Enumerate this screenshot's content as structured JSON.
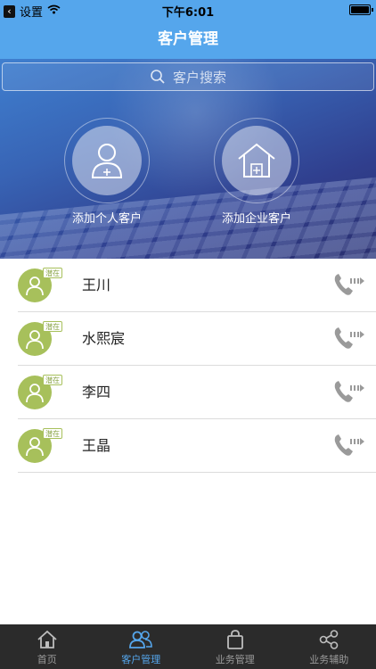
{
  "status_bar": {
    "back_label": "设置",
    "time": "下午6:01"
  },
  "nav": {
    "title": "客户管理"
  },
  "hero": {
    "search": {
      "placeholder": "客户搜索"
    },
    "actions": [
      {
        "label": "添加个人客户",
        "icon": "person-add-icon"
      },
      {
        "label": "添加企业客户",
        "icon": "house-add-icon"
      }
    ]
  },
  "customers": [
    {
      "name": "王川",
      "status": "潜在"
    },
    {
      "name": "水熙宸",
      "status": "潜在"
    },
    {
      "name": "李四",
      "status": "潜在"
    },
    {
      "name": "王晶",
      "status": "潜在"
    }
  ],
  "tabs": [
    {
      "label": "首页",
      "icon": "home-icon"
    },
    {
      "label": "客户管理",
      "icon": "customers-icon",
      "active": true
    },
    {
      "label": "业务管理",
      "icon": "bag-icon"
    },
    {
      "label": "业务辅助",
      "icon": "share-nodes-icon"
    }
  ],
  "colors": {
    "accent": "#55a6ec",
    "avatar": "#a7c05b",
    "tab_bar": "#2b2b2b"
  }
}
